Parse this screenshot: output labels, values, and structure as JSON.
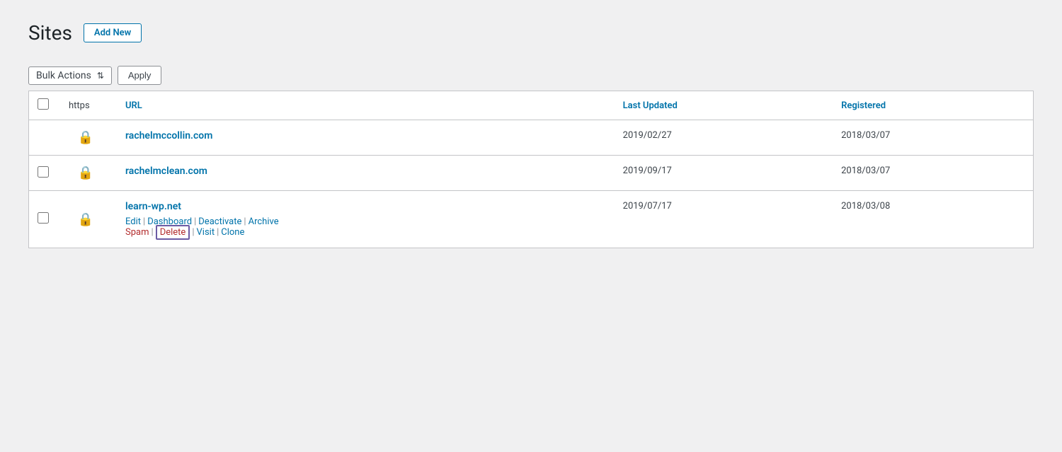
{
  "header": {
    "title": "Sites",
    "add_new_label": "Add New"
  },
  "toolbar": {
    "bulk_actions_label": "Bulk Actions",
    "bulk_actions_arrows": "⇅",
    "apply_label": "Apply"
  },
  "table": {
    "columns": {
      "https": "https",
      "url": "URL",
      "last_updated": "Last Updated",
      "registered": "Registered"
    },
    "rows": [
      {
        "id": 1,
        "checked": true,
        "https": true,
        "url": "rachelmccollin.com",
        "last_updated": "2019/02/27",
        "registered": "2018/03/07",
        "actions": []
      },
      {
        "id": 2,
        "checked": false,
        "https": true,
        "url": "rachelmclean.com",
        "last_updated": "2019/09/17",
        "registered": "2018/03/07",
        "actions": []
      },
      {
        "id": 3,
        "checked": false,
        "https": true,
        "url": "learn-wp.net",
        "last_updated": "2019/07/17",
        "registered": "2018/03/08",
        "actions": [
          {
            "label": "Edit",
            "class": ""
          },
          {
            "label": "Dashboard",
            "class": ""
          },
          {
            "label": "Deactivate",
            "class": ""
          },
          {
            "label": "Archive",
            "class": ""
          },
          {
            "label": "Spam",
            "class": "spam"
          },
          {
            "label": "Delete",
            "class": "delete"
          },
          {
            "label": "Visit",
            "class": ""
          },
          {
            "label": "Clone",
            "class": ""
          }
        ]
      }
    ]
  }
}
